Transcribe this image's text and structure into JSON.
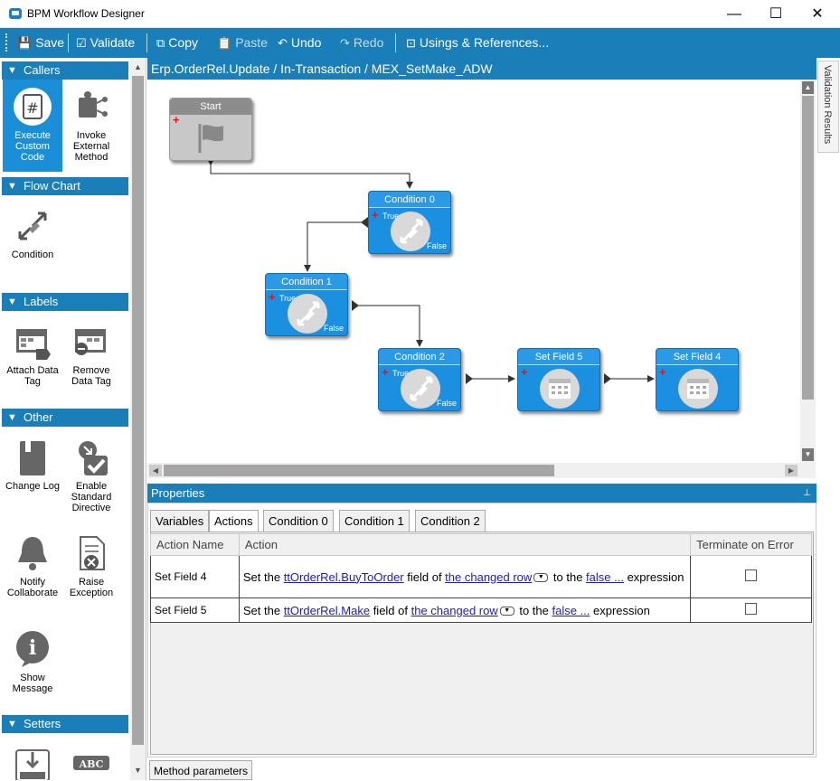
{
  "window": {
    "title": "BPM Workflow Designer",
    "minimize": "—",
    "maximize": "☐",
    "close": "✕"
  },
  "toolbar": {
    "save": "Save",
    "validate": "Validate",
    "copy": "Copy",
    "paste": "Paste",
    "undo": "Undo",
    "redo": "Redo",
    "usings": "Usings & References..."
  },
  "toolbox": {
    "sections": {
      "callers": "Callers",
      "flow_chart": "Flow Chart",
      "labels": "Labels",
      "other": "Other",
      "setters": "Setters"
    },
    "items": {
      "execute_custom_code": "Execute Custom Code",
      "invoke_external_method": "Invoke External Method",
      "condition": "Condition",
      "attach_data_tag": "Attach Data Tag",
      "remove_data_tag": "Remove Data Tag",
      "change_log": "Change Log",
      "enable_standard_directive": "Enable Standard Directive",
      "notify_collaborate": "Notify Collaborate",
      "raise_exception": "Raise Exception",
      "show_message": "Show Message",
      "setter_abc": "ABC"
    }
  },
  "designer": {
    "breadcrumb": "Erp.OrderRel.Update / In-Transaction / MEX_SetMake_ADW",
    "nodes": {
      "start": "Start",
      "condition0": "Condition 0",
      "condition1": "Condition 1",
      "condition2": "Condition 2",
      "setfield5": "Set Field 5",
      "setfield4": "Set Field 4",
      "true_label": "True",
      "false_label": "False"
    },
    "validation_tab": "Validation Results"
  },
  "properties": {
    "title": "Properties",
    "pin": "📌",
    "tabs": [
      "Variables",
      "Actions",
      "Condition 0",
      "Condition 1",
      "Condition 2"
    ],
    "columns": [
      "Action Name",
      "Action",
      "Terminate on Error"
    ],
    "rows": [
      {
        "name": "Set Field 4",
        "p1": "Set the ",
        "field": "ttOrderRel.BuyToOrder",
        "p2": " field of ",
        "row": "the changed row",
        "p3": " to the ",
        "value": " false ...",
        "p4": " expression"
      },
      {
        "name": "Set Field 5",
        "p1": "Set the ",
        "field": "ttOrderRel.Make",
        "p2": " field of ",
        "row": "the changed row",
        "p3": " to the ",
        "value": " false ...",
        "p4": " expression"
      }
    ]
  },
  "bottom_tab": "Method parameters",
  "colors": {
    "accent": "#1a7fb8",
    "node": "#1b8fe0",
    "selected": "#1a8fd8"
  }
}
